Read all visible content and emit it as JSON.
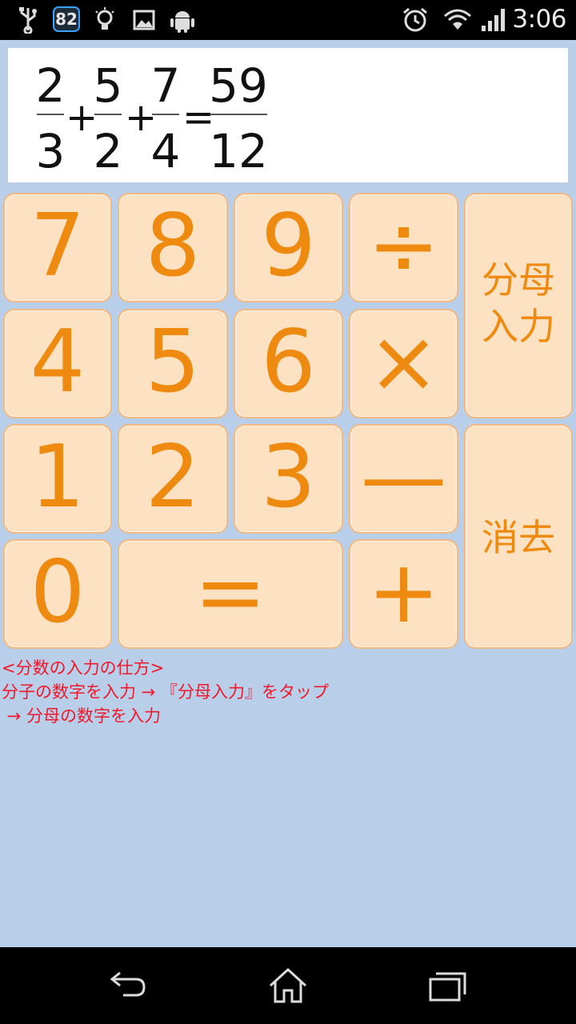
{
  "status_bar": {
    "badge": "82",
    "time": "3:06",
    "left_icons": [
      "usb-icon",
      "badge-82-icon",
      "lightbulb-icon",
      "image-icon",
      "android-icon"
    ],
    "right_icons": [
      "alarm-icon",
      "wifi-icon",
      "signal-icon"
    ]
  },
  "display": {
    "terms": [
      {
        "numerator": "2",
        "denominator": "3"
      },
      {
        "numerator": "5",
        "denominator": "2"
      },
      {
        "numerator": "7",
        "denominator": "4"
      }
    ],
    "operators": [
      "+",
      "+",
      "="
    ],
    "result": {
      "numerator": "59",
      "denominator": "12"
    }
  },
  "keypad": {
    "k7": "7",
    "k8": "8",
    "k9": "9",
    "divide": "÷",
    "k4": "4",
    "k5": "5",
    "k6": "6",
    "multiply": "×",
    "k1": "1",
    "k2": "2",
    "k3": "3",
    "minus": "—",
    "k0": "0",
    "equals": "=",
    "plus": "+",
    "denominator_line1": "分母",
    "denominator_line2": "入力",
    "clear": "消去"
  },
  "help": {
    "line1": "<分数の入力の仕方>",
    "line2": "分子の数字を入力 → 『分母入力』をタップ",
    "line3": " → 分母の数字を入力"
  },
  "colors": {
    "background": "#b9cfe9",
    "key_fill": "#fce1c3",
    "key_border": "#f2b982",
    "key_text": "#ef8a10",
    "help_text": "#f0182a"
  }
}
